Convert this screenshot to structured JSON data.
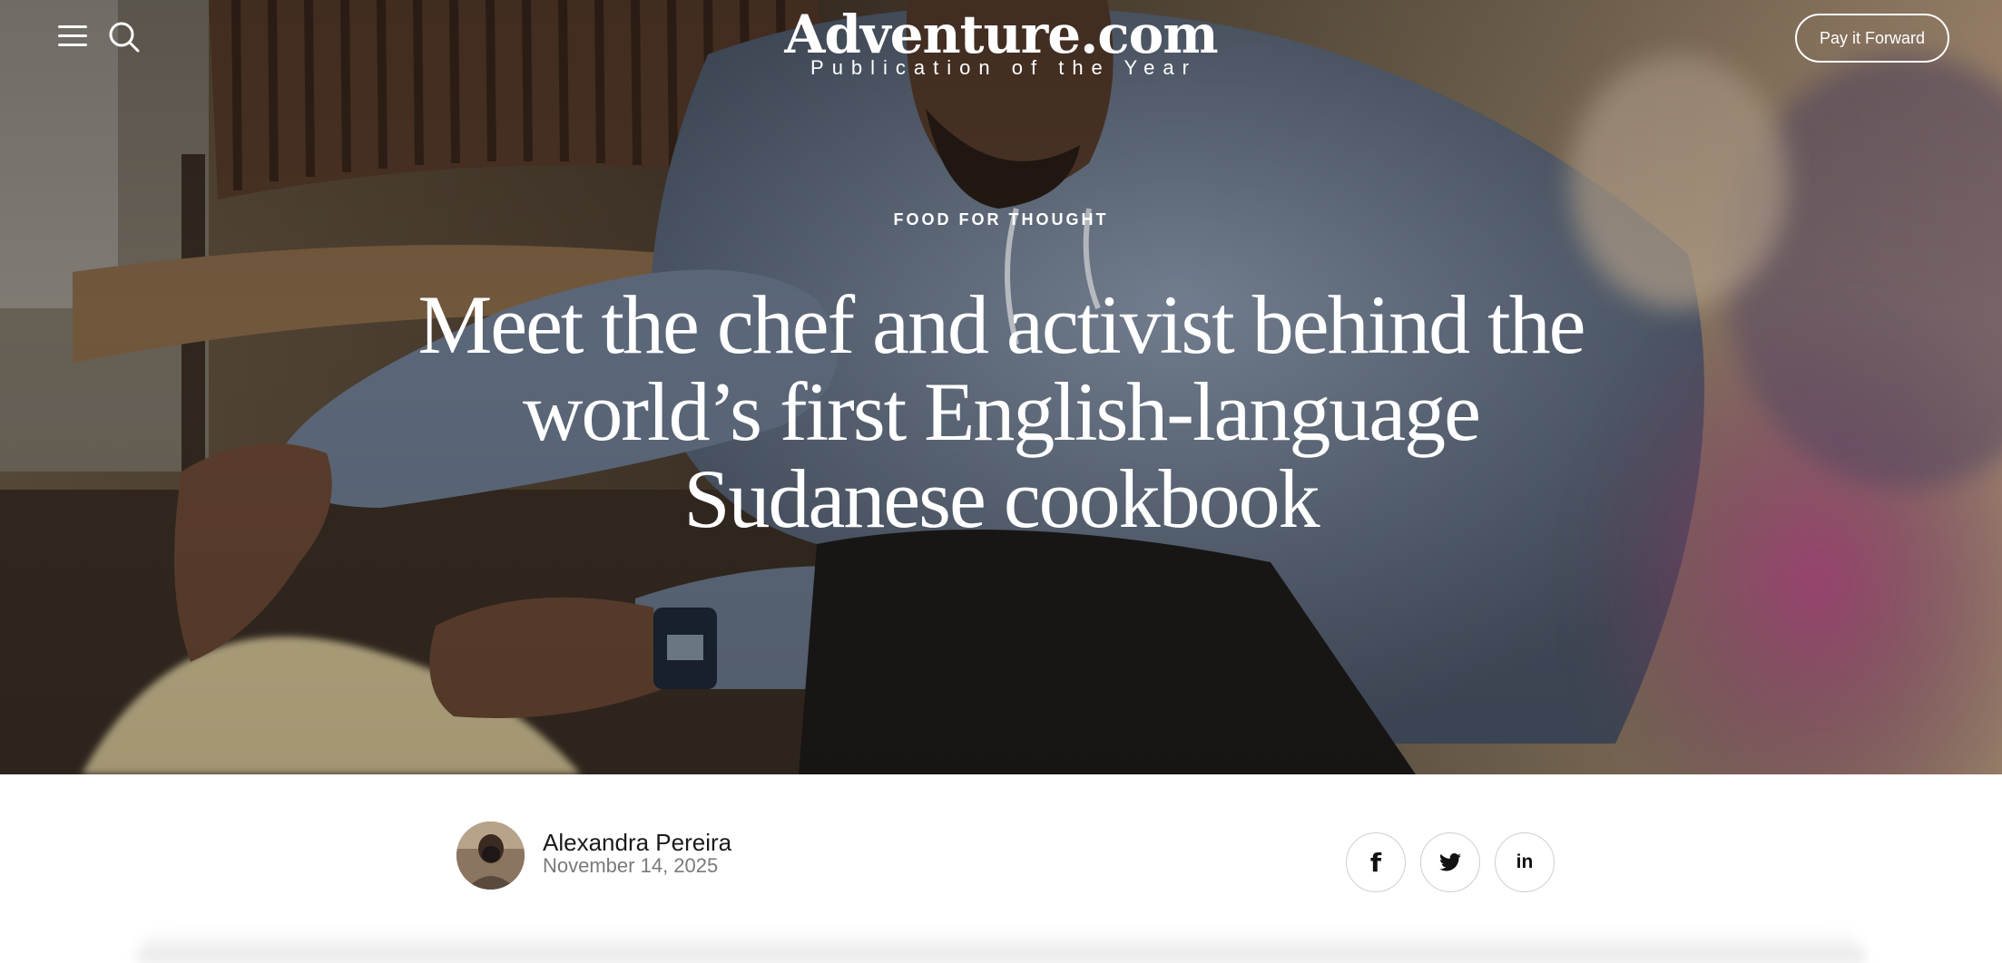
{
  "header": {
    "menu_icon": "hamburger-menu-icon",
    "search_icon": "search-icon",
    "brand_name": "Adventure.com",
    "brand_tagline": "Publication of the Year",
    "cta_label": "Pay it Forward"
  },
  "article": {
    "category": "FOOD FOR THOUGHT",
    "headline_lines": [
      "Meet the chef and activist behind the",
      "world’s first English-language",
      "Sudanese cookbook"
    ]
  },
  "byline": {
    "author_name": "Alexandra Pereira",
    "date": "November 14, 2025",
    "avatar_icon": "author-avatar"
  },
  "share": {
    "facebook_glyph": "f",
    "twitter_icon": "twitter-icon",
    "linkedin_glyph": "in"
  },
  "colors": {
    "hero_text": "#ffffff",
    "byline_name": "#1a1a1a",
    "byline_date": "#7a7a7a",
    "share_border": "#cfcfcf"
  }
}
